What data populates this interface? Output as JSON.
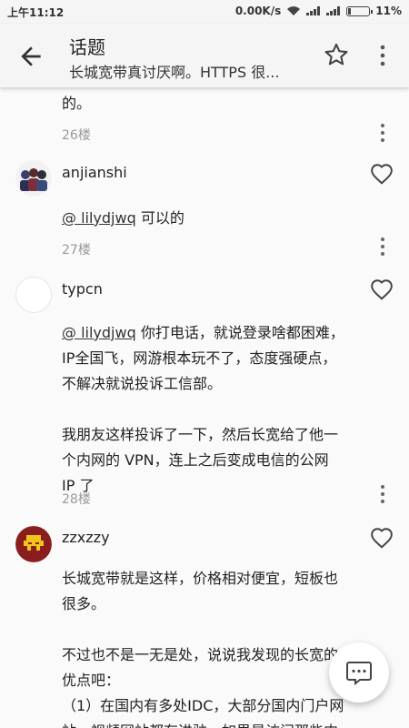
{
  "status_bar": {
    "time": "上午11:12",
    "net_speed": "0.00K/s",
    "battery": "11%"
  },
  "app_bar": {
    "title": "话题",
    "subtitle": "长城宽带真讨厌啊。HTTPS 很..."
  },
  "posts": [
    {
      "cut_text": "的。",
      "floor": "26楼"
    },
    {
      "username": "anjianshi",
      "mention": "@ lilydjwq",
      "body": " 可以的",
      "floor": "27楼"
    },
    {
      "username": "typcn",
      "mention": "@ lilydjwq",
      "line1": " 你打电话，就说登录啥都困难，",
      "line2": "IP全国飞，网游根本玩不了，态度强硬点，",
      "line3": "不解决就说投诉工信部。",
      "para2_line1": "我朋友这样投诉了一下，然后长宽给了他一",
      "para2_line2": "个内网的 VPN，连上之后变成电信的公网",
      "para2_line3": "IP 了",
      "floor": "28楼"
    },
    {
      "username": "zzxzzy",
      "line1": "长城宽带就是这样，价格相对便宜，短板也",
      "line2": "很多。",
      "line3": "不过也不是一无是处，说说我发现的长宽的",
      "line4": "优点吧：",
      "line5": "（1）在国内有多处IDC，大部分国内门户网",
      "line6": "站、视频网站都有进驻，如果是访问那些内"
    }
  ],
  "icons": {
    "back": "arrow-back-icon",
    "star": "star-icon",
    "more": "more-vert-icon",
    "heart": "heart-outline-icon",
    "fab": "comment-icon"
  }
}
